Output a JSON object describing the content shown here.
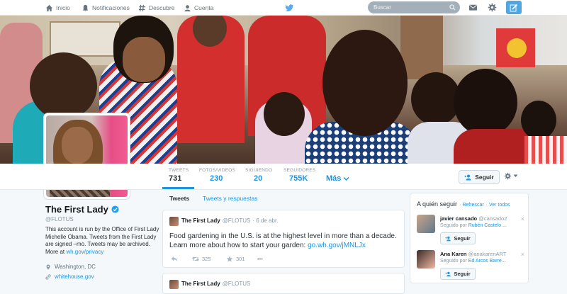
{
  "nav": {
    "home": "Inicio",
    "notifications": "Notificaciones",
    "discover": "Descubre",
    "account": "Cuenta",
    "search_placeholder": "Buscar"
  },
  "colors": {
    "accent": "#1b95e0",
    "compose": "#4ea6e3",
    "avatar_pink": "#f25a92"
  },
  "stats": {
    "tweets_label": "TWEETS",
    "tweets_value": "731",
    "media_label": "FOTOS/VIDEOS",
    "media_value": "230",
    "following_label": "SIGUIENDO",
    "following_value": "20",
    "followers_label": "SEGUIDORES",
    "followers_value": "755K",
    "more_label": "Más",
    "follow_label": "Seguir"
  },
  "profile": {
    "name": "The First Lady",
    "handle": "@FLOTUS",
    "bio": "This account is run by the Office of First Lady Michelle Obama. Tweets from the First Lady are signed –mo. Tweets may be archived. More at",
    "bio_link": "wh.gov/privacy",
    "location": "Washington, DC",
    "website": "whitehouse.gov"
  },
  "timeline": {
    "tab_tweets": "Tweets",
    "tab_replies": "Tweets y respuestas",
    "tweet": {
      "name": "The First Lady",
      "handle": "@FLOTUS",
      "date": "· 6 de abr.",
      "text": "Food gardening in the U.S. is at the highest level in more than a decade. Learn more about how to start your garden:",
      "link": "go.wh.gov/jMNLJx",
      "retweets": "325",
      "favorites": "301",
      "more": "•••"
    },
    "tweet2": {
      "name": "The First Lady",
      "handle": "@FLOTUS"
    }
  },
  "who_to_follow": {
    "title": "A quién seguir",
    "refresh": "· Refrescar",
    "view_all": "· Ver todos",
    "users": [
      {
        "name": "javier cansado",
        "handle": "@cansado2",
        "followed_by_prefix": "Seguido por",
        "followed_by": "Rubén Castelo ...",
        "follow": "Seguir",
        "close": "×"
      },
      {
        "name": "Ana Karen",
        "handle": "@anakarenART",
        "followed_by_prefix": "Seguido por",
        "followed_by": "Ed Arcos Barre...",
        "follow": "Seguir",
        "close": "×"
      }
    ]
  }
}
